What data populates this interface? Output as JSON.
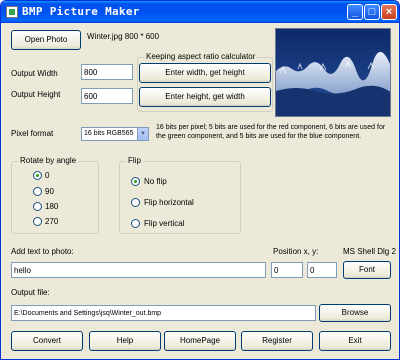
{
  "window": {
    "title": "BMP Picture Maker"
  },
  "file": {
    "open_label": "Open Photo",
    "info": "Winter.jpg 800 * 600"
  },
  "size": {
    "width_label": "Output Width",
    "width_value": "800",
    "height_label": "Output Height",
    "height_value": "600",
    "calculator_title": "Keeping aspect ratio calculator",
    "width_btn": "Enter width, get height",
    "height_btn": "Enter height, get width"
  },
  "pixel": {
    "label": "Pixel format",
    "selected": "16 bits RGB565",
    "description": "16 bits per pixel; 5 bits are used for the red component, 6 bits are used for the green component, and 5 bits are used for the blue component."
  },
  "rotate": {
    "title": "Rotate by angle",
    "options": [
      "0",
      "90",
      "180",
      "270"
    ],
    "selected": "0"
  },
  "flip": {
    "title": "Flip",
    "options": [
      "No flip",
      "Flip horizontal",
      "Flip vertical"
    ],
    "selected": "No flip"
  },
  "text": {
    "label": "Add text to photo:",
    "value": "hello",
    "position_label": "Position x, y:",
    "x": "0",
    "y": "0",
    "font_name": "MS Shell Dlg 2",
    "font_btn": "Font"
  },
  "output": {
    "label": "Output file:",
    "path": "E:\\Documents and Settings\\jsq\\Winter_out.bmp",
    "browse": "Browse"
  },
  "actions": [
    "Convert",
    "Help",
    "HomePage",
    "Register",
    "Exit"
  ],
  "colors": {
    "titlebar": "#0053ee",
    "panel": "#ece9d8",
    "accent": "#003c74"
  }
}
